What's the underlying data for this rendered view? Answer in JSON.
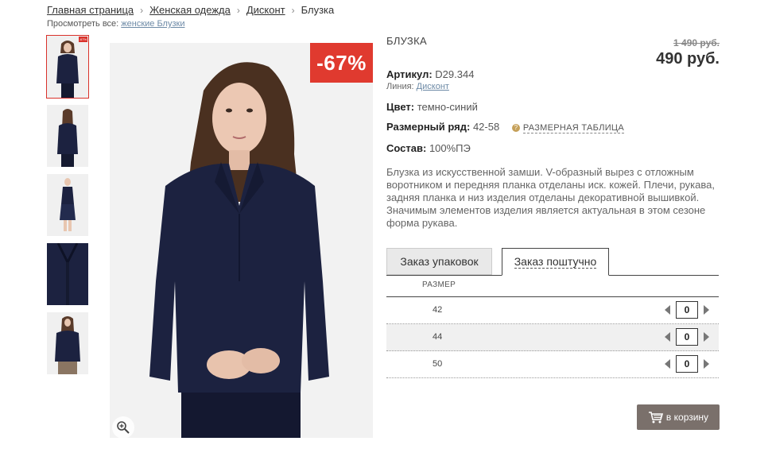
{
  "breadcrumb": {
    "items": [
      "Главная страница",
      "Женская одежда",
      "Дисконт"
    ],
    "current": "Блузка"
  },
  "viewall": {
    "prefix": "Просмотреть все:",
    "link": "женские Блузки"
  },
  "thumbnails": {
    "badge": "-67%",
    "count": 5
  },
  "photo": {
    "discount_badge": "-67%",
    "zoom_icon": "magnifier-plus-icon"
  },
  "product": {
    "title": "БЛУЗКА",
    "old_price": "1 490 руб.",
    "new_price": "490 руб.",
    "article_label": "Артикул:",
    "article_value": "D29.344",
    "line_label": "Линия:",
    "line_value": "Дисконт",
    "color_label": "Цвет:",
    "color_value": "темно-синий",
    "size_range_label": "Размерный ряд:",
    "size_range_value": "42-58",
    "help_icon": "?",
    "size_table_link": "РАЗМЕРНАЯ ТАБЛИЦА",
    "composition_label": "Состав:",
    "composition_value": "100%ПЭ",
    "description": "Блузка из искусственной замши. V-образный вырез с отложным воротником и передняя планка отделаны иск. кожей. Плечи, рукава, задняя планка и низ изделия отделаны декоративной вышивкой. Значимым элементов изделия является актуальная в этом сезоне форма рукава."
  },
  "tabs": {
    "pack_order": "Заказ упаковок",
    "piece_order": "Заказ поштучно"
  },
  "sizes": {
    "header": "РАЗМЕР",
    "rows": [
      {
        "size": "42",
        "qty": "0"
      },
      {
        "size": "44",
        "qty": "0"
      },
      {
        "size": "50",
        "qty": "0"
      }
    ]
  },
  "cart": {
    "label": "в корзину",
    "icon": "shopping-cart-icon"
  },
  "colors": {
    "accent_red": "#e03a2f",
    "cart_button": "#7a706b",
    "link_blue": "#6d8aa6",
    "garment_navy": "#1c2240"
  }
}
